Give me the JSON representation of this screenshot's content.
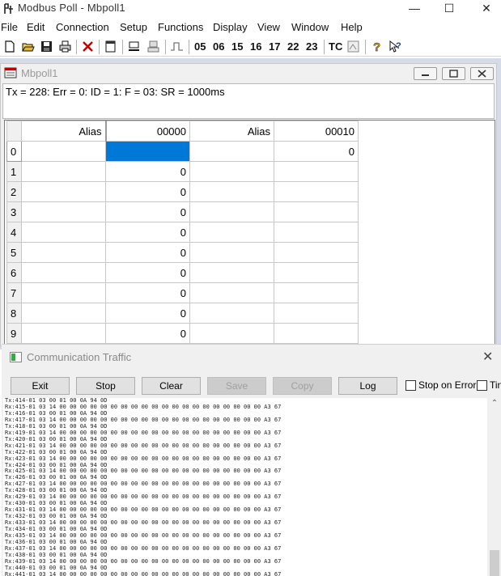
{
  "window": {
    "title": "Modbus Poll - Mbpoll1",
    "minimize_glyph": "—",
    "maximize_glyph": "☐",
    "close_glyph": "✕"
  },
  "menu": [
    "File",
    "Edit",
    "Connection",
    "Setup",
    "Functions",
    "Display",
    "View",
    "Window",
    "Help"
  ],
  "toolbar": {
    "icons": [
      "new-icon",
      "open-icon",
      "save-icon",
      "print-icon",
      "delete-icon",
      "window-icon",
      "read-write-icon",
      "monitor-icon",
      "pulse-icon",
      "traffic-icon",
      "help-icon",
      "context-help-icon"
    ],
    "function_codes": [
      "05",
      "06",
      "15",
      "16",
      "17",
      "22",
      "23"
    ],
    "tc_label": "TC"
  },
  "child": {
    "title": "Mbpoll1",
    "status": "Tx = 228: Err = 0: ID = 1: F = 03: SR = 1000ms",
    "columns": [
      "Alias",
      "00000",
      "Alias",
      "00010"
    ],
    "rows": [
      {
        "idx": "0",
        "a1": "",
        "v1": "",
        "a2": "",
        "v2": "0"
      },
      {
        "idx": "1",
        "a1": "",
        "v1": "0",
        "a2": "",
        "v2": ""
      },
      {
        "idx": "2",
        "a1": "",
        "v1": "0",
        "a2": "",
        "v2": ""
      },
      {
        "idx": "3",
        "a1": "",
        "v1": "0",
        "a2": "",
        "v2": ""
      },
      {
        "idx": "4",
        "a1": "",
        "v1": "0",
        "a2": "",
        "v2": ""
      },
      {
        "idx": "5",
        "a1": "",
        "v1": "0",
        "a2": "",
        "v2": ""
      },
      {
        "idx": "6",
        "a1": "",
        "v1": "0",
        "a2": "",
        "v2": ""
      },
      {
        "idx": "7",
        "a1": "",
        "v1": "0",
        "a2": "",
        "v2": ""
      },
      {
        "idx": "8",
        "a1": "",
        "v1": "0",
        "a2": "",
        "v2": ""
      },
      {
        "idx": "9",
        "a1": "",
        "v1": "0",
        "a2": "",
        "v2": ""
      }
    ]
  },
  "comm": {
    "title": "Communication Traffic",
    "close_glyph": "✕",
    "buttons": {
      "exit": "Exit",
      "stop": "Stop",
      "clear": "Clear",
      "save": "Save",
      "copy": "Copy",
      "log": "Log"
    },
    "stop_on_error": "Stop on Error",
    "time_label": "Tin",
    "lines": [
      "Tx:414-01 03 00 01 00 0A 94 0D",
      "Rx:415-01 03 14 00 00 00 00 00 00 00 00 00 00 00 00 00 00 00 00 00 00 00 00 A3 67",
      "Tx:416-01 03 00 01 00 0A 94 0D",
      "Rx:417-01 03 14 00 00 00 00 00 00 00 00 00 00 00 00 00 00 00 00 00 00 00 00 A3 67",
      "Tx:418-01 03 00 01 00 0A 94 0D",
      "Rx:419-01 03 14 00 00 00 00 00 00 00 00 00 00 00 00 00 00 00 00 00 00 00 00 A3 67",
      "Tx:420-01 03 00 01 00 0A 94 0D",
      "Rx:421-01 03 14 00 00 00 00 00 00 00 00 00 00 00 00 00 00 00 00 00 00 00 00 A3 67",
      "Tx:422-01 03 00 01 00 0A 94 0D",
      "Rx:423-01 03 14 00 00 00 00 00 00 00 00 00 00 00 00 00 00 00 00 00 00 00 00 A3 67",
      "Tx:424-01 03 00 01 00 0A 94 0D",
      "Rx:425-01 03 14 00 00 00 00 00 00 00 00 00 00 00 00 00 00 00 00 00 00 00 00 A3 67",
      "Tx:426-01 03 00 01 00 0A 94 0D",
      "Rx:427-01 03 14 00 00 00 00 00 00 00 00 00 00 00 00 00 00 00 00 00 00 00 00 A3 67",
      "Tx:428-01 03 00 01 00 0A 94 0D",
      "Rx:429-01 03 14 00 00 00 00 00 00 00 00 00 00 00 00 00 00 00 00 00 00 00 00 A3 67",
      "Tx:430-01 03 00 01 00 0A 94 0D",
      "Rx:431-01 03 14 00 00 00 00 00 00 00 00 00 00 00 00 00 00 00 00 00 00 00 00 A3 67",
      "Tx:432-01 03 00 01 00 0A 94 0D",
      "Rx:433-01 03 14 00 00 00 00 00 00 00 00 00 00 00 00 00 00 00 00 00 00 00 00 A3 67",
      "Tx:434-01 03 00 01 00 0A 94 0D",
      "Rx:435-01 03 14 00 00 00 00 00 00 00 00 00 00 00 00 00 00 00 00 00 00 00 00 A3 67",
      "Tx:436-01 03 00 01 00 0A 94 0D",
      "Rx:437-01 03 14 00 00 00 00 00 00 00 00 00 00 00 00 00 00 00 00 00 00 00 00 A3 67",
      "Tx:438-01 03 00 01 00 0A 94 0D",
      "Rx:439-01 03 14 00 00 00 00 00 00 00 00 00 00 00 00 00 00 00 00 00 00 00 00 A3 67",
      "Tx:440-01 03 00 01 00 0A 94 0D",
      "Rx:441-01 03 14 00 00 00 00 00 00 00 00 00 00 00 00 00 00 00 00 00 00 00 00 A3 67"
    ]
  },
  "colors": {
    "selection": "#0078d7",
    "mdi_background": "#d6dbe9"
  }
}
